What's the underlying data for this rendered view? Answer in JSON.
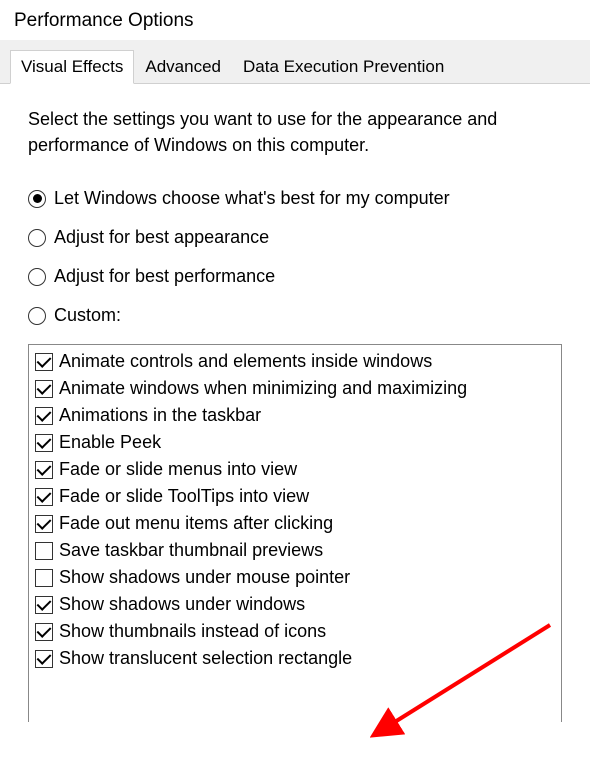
{
  "window": {
    "title": "Performance Options"
  },
  "tabs": [
    {
      "label": "Visual Effects"
    },
    {
      "label": "Advanced"
    },
    {
      "label": "Data Execution Prevention"
    }
  ],
  "description": "Select the settings you want to use for the appearance and performance of Windows on this computer.",
  "radios": [
    {
      "label": "Let Windows choose what's best for my computer"
    },
    {
      "label": "Adjust for best appearance"
    },
    {
      "label": "Adjust for best performance"
    },
    {
      "label": "Custom:"
    }
  ],
  "checkboxes": [
    {
      "label": "Animate controls and elements inside windows",
      "checked": true
    },
    {
      "label": "Animate windows when minimizing and maximizing",
      "checked": true
    },
    {
      "label": "Animations in the taskbar",
      "checked": true
    },
    {
      "label": "Enable Peek",
      "checked": true
    },
    {
      "label": "Fade or slide menus into view",
      "checked": true
    },
    {
      "label": "Fade or slide ToolTips into view",
      "checked": true
    },
    {
      "label": "Fade out menu items after clicking",
      "checked": true
    },
    {
      "label": "Save taskbar thumbnail previews",
      "checked": false
    },
    {
      "label": "Show shadows under mouse pointer",
      "checked": false
    },
    {
      "label": "Show shadows under windows",
      "checked": true
    },
    {
      "label": "Show thumbnails instead of icons",
      "checked": true
    },
    {
      "label": "Show translucent selection rectangle",
      "checked": true
    }
  ],
  "annotation": {
    "arrow_color": "#ff0000"
  }
}
